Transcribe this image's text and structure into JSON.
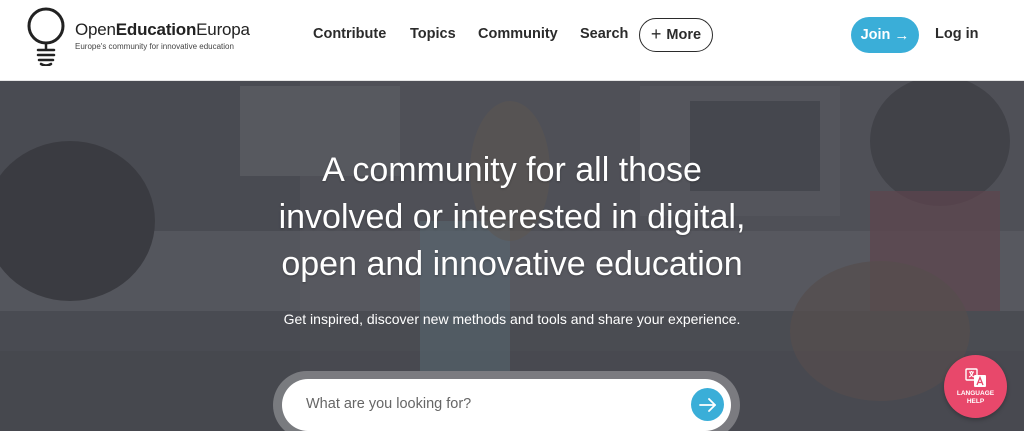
{
  "brand": {
    "name_part1": "Open",
    "name_part2": "Education",
    "name_part3": "Europa",
    "tagline": "Europe's community for innovative education",
    "accent_color": "#3aaed8"
  },
  "nav": {
    "items": [
      {
        "label": "Contribute"
      },
      {
        "label": "Topics"
      },
      {
        "label": "Community"
      },
      {
        "label": "Search"
      }
    ],
    "more_label": "More",
    "more_icon": "plus-icon",
    "join_label": "Join",
    "join_icon": "arrow-right-icon",
    "login_label": "Log in"
  },
  "hero": {
    "title_lines": [
      "A community for all those",
      "involved or interested in digital,",
      "open and innovative education"
    ],
    "subtitle": "Get inspired, discover new methods and tools and share your experience.",
    "search_placeholder": "What are you looking for?",
    "search_icon": "arrow-right-icon"
  },
  "language_help": {
    "line1": "LANGUAGE",
    "line2": "HELP",
    "icon": "translate-icon",
    "color": "#e8486b"
  }
}
